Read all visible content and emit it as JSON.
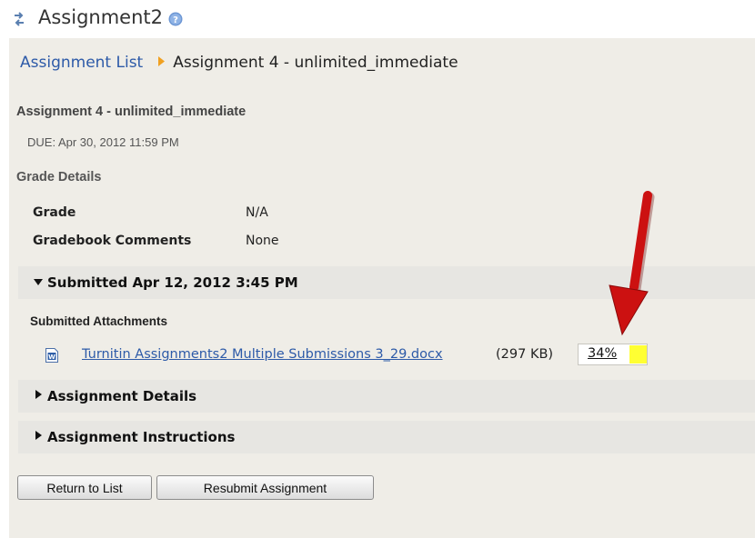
{
  "tool": {
    "title": "Assignment2",
    "swap_icon": "swap-arrows-icon",
    "help_icon": "help-icon"
  },
  "breadcrumb": {
    "link_label": "Assignment List",
    "separator_icon": "orange-arrow-right-icon",
    "current": "Assignment 4 - unlimited_immediate"
  },
  "assignment": {
    "title": "Assignment 4 - unlimited_immediate",
    "due": "DUE: Apr 30, 2012 11:59 PM"
  },
  "grade_details": {
    "heading": "Grade Details",
    "rows": [
      {
        "label": "Grade",
        "value": "N/A"
      },
      {
        "label": "Gradebook Comments",
        "value": "None"
      }
    ]
  },
  "submission": {
    "header": "Submitted Apr 12, 2012 3:45 PM",
    "expanded": true,
    "attachments_heading": "Submitted Attachments",
    "attachment": {
      "icon": "word-document-icon",
      "filename": "Turnitin Assignments2 Multiple Submissions 3_29.docx",
      "size": "(297 KB)",
      "similarity": "34%",
      "similarity_color": "#ffff33"
    }
  },
  "sections": [
    {
      "label": "Assignment Details",
      "expanded": false
    },
    {
      "label": "Assignment Instructions",
      "expanded": false
    }
  ],
  "buttons": {
    "return": "Return to List",
    "resubmit": "Resubmit Assignment"
  },
  "annotation": {
    "arrow_color": "#cc1111"
  },
  "colors": {
    "panel_bg": "#efede7",
    "section_bar_bg": "#e7e6e2",
    "link": "#2d5aa8"
  }
}
